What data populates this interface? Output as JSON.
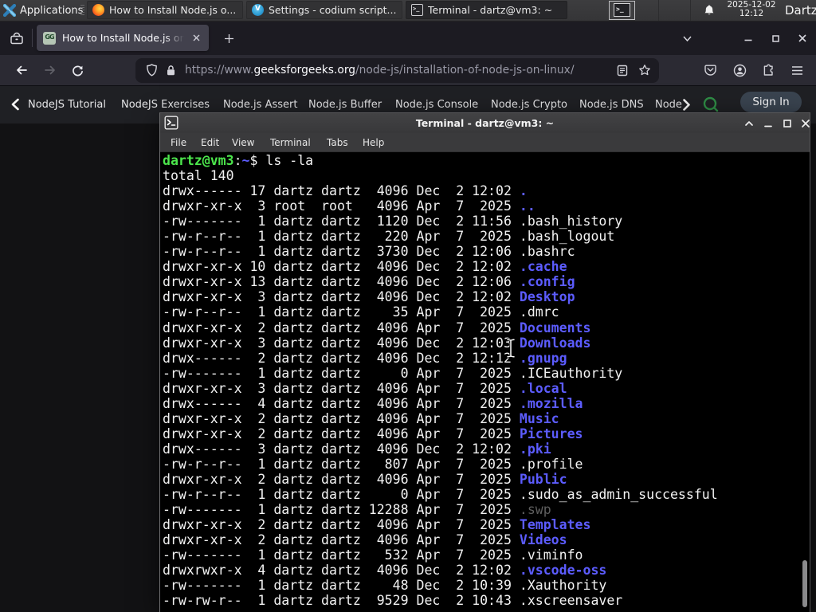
{
  "panel": {
    "applications_label": "Applications",
    "tasks": [
      {
        "app": "firefox",
        "title": "How to Install Node.js o..."
      },
      {
        "app": "codium",
        "title": "Settings - codium script..."
      },
      {
        "app": "terminal",
        "title": "Terminal - dartz@vm3: ~",
        "active": true
      }
    ],
    "clock_date": "2025-12-02",
    "clock_time": "12:12",
    "user_label": "Dartz"
  },
  "browser": {
    "tab_title": "How to Install Node.js on",
    "url_prefix": "https://www.",
    "url_domain": "geeksforgeeks.org",
    "url_path": "/node-js/installation-of-node-js-on-linux/"
  },
  "site_nav": {
    "items": [
      "NodeJS Tutorial",
      "NodeJS Exercises",
      "Node.js Assert",
      "Node.js Buffer",
      "Node.js Console",
      "Node.js Crypto",
      "Node.js DNS",
      "Node"
    ],
    "sign_in_label": "Sign In",
    "accent_green": "#2f8d46"
  },
  "terminal": {
    "title": "Terminal - dartz@vm3: ~",
    "menus": [
      "File",
      "Edit",
      "View",
      "Terminal",
      "Tabs",
      "Help"
    ],
    "colors": {
      "prompt_green": "#4ce64c",
      "dir_blue": "#5c5cff",
      "dim": "#5e5e5e",
      "fg": "#f2f2f2",
      "bg": "#000000"
    },
    "lines": [
      [
        [
          "g",
          "dartz@vm3"
        ],
        [
          "w",
          ":"
        ],
        [
          "b",
          "~"
        ],
        [
          "w",
          "$ ls -la"
        ]
      ],
      [
        [
          "w",
          "total 140"
        ]
      ],
      [
        [
          "w",
          "drwx------ 17 dartz dartz  4096 Dec  2 12:02 "
        ],
        [
          "b",
          "."
        ]
      ],
      [
        [
          "w",
          "drwxr-xr-x  3 root  root   4096 Apr  7  2025 "
        ],
        [
          "b",
          ".."
        ]
      ],
      [
        [
          "w",
          "-rw-------  1 dartz dartz  1120 Dec  2 11:56 .bash_history"
        ]
      ],
      [
        [
          "w",
          "-rw-r--r--  1 dartz dartz   220 Apr  7  2025 .bash_logout"
        ]
      ],
      [
        [
          "w",
          "-rw-r--r--  1 dartz dartz  3730 Dec  2 12:06 .bashrc"
        ]
      ],
      [
        [
          "w",
          "drwxr-xr-x 10 dartz dartz  4096 Dec  2 12:02 "
        ],
        [
          "b",
          ".cache"
        ]
      ],
      [
        [
          "w",
          "drwxr-xr-x 13 dartz dartz  4096 Dec  2 12:06 "
        ],
        [
          "b",
          ".config"
        ]
      ],
      [
        [
          "w",
          "drwxr-xr-x  3 dartz dartz  4096 Dec  2 12:02 "
        ],
        [
          "b",
          "Desktop"
        ]
      ],
      [
        [
          "w",
          "-rw-r--r--  1 dartz dartz    35 Apr  7  2025 .dmrc"
        ]
      ],
      [
        [
          "w",
          "drwxr-xr-x  2 dartz dartz  4096 Apr  7  2025 "
        ],
        [
          "b",
          "Documents"
        ]
      ],
      [
        [
          "w",
          "drwxr-xr-x  3 dartz dartz  4096 Dec  2 12:03 "
        ],
        [
          "b",
          "Downloads"
        ]
      ],
      [
        [
          "w",
          "drwx------  2 dartz dartz  4096 Dec  2 12:12 "
        ],
        [
          "b",
          ".gnupg"
        ]
      ],
      [
        [
          "w",
          "-rw-------  1 dartz dartz     0 Apr  7  2025 .ICEauthority"
        ]
      ],
      [
        [
          "w",
          "drwxr-xr-x  3 dartz dartz  4096 Apr  7  2025 "
        ],
        [
          "b",
          ".local"
        ]
      ],
      [
        [
          "w",
          "drwx------  4 dartz dartz  4096 Apr  7  2025 "
        ],
        [
          "b",
          ".mozilla"
        ]
      ],
      [
        [
          "w",
          "drwxr-xr-x  2 dartz dartz  4096 Apr  7  2025 "
        ],
        [
          "b",
          "Music"
        ]
      ],
      [
        [
          "w",
          "drwxr-xr-x  2 dartz dartz  4096 Apr  7  2025 "
        ],
        [
          "b",
          "Pictures"
        ]
      ],
      [
        [
          "w",
          "drwx------  3 dartz dartz  4096 Dec  2 12:02 "
        ],
        [
          "b",
          ".pki"
        ]
      ],
      [
        [
          "w",
          "-rw-r--r--  1 dartz dartz   807 Apr  7  2025 .profile"
        ]
      ],
      [
        [
          "w",
          "drwxr-xr-x  2 dartz dartz  4096 Apr  7  2025 "
        ],
        [
          "b",
          "Public"
        ]
      ],
      [
        [
          "w",
          "-rw-r--r--  1 dartz dartz     0 Apr  7  2025 .sudo_as_admin_successful"
        ]
      ],
      [
        [
          "w",
          "-rw-------  1 dartz dartz 12288 Apr  7  2025 "
        ],
        [
          "d",
          ".swp"
        ]
      ],
      [
        [
          "w",
          "drwxr-xr-x  2 dartz dartz  4096 Apr  7  2025 "
        ],
        [
          "b",
          "Templates"
        ]
      ],
      [
        [
          "w",
          "drwxr-xr-x  2 dartz dartz  4096 Apr  7  2025 "
        ],
        [
          "b",
          "Videos"
        ]
      ],
      [
        [
          "w",
          "-rw-------  1 dartz dartz   532 Apr  7  2025 .viminfo"
        ]
      ],
      [
        [
          "w",
          "drwxrwxr-x  4 dartz dartz  4096 Dec  2 12:02 "
        ],
        [
          "b",
          ".vscode-oss"
        ]
      ],
      [
        [
          "w",
          "-rw-------  1 dartz dartz    48 Dec  2 10:39 .Xauthority"
        ]
      ],
      [
        [
          "w",
          "-rw-rw-r--  1 dartz dartz  9529 Dec  2 10:43 .xscreensaver"
        ]
      ]
    ]
  }
}
